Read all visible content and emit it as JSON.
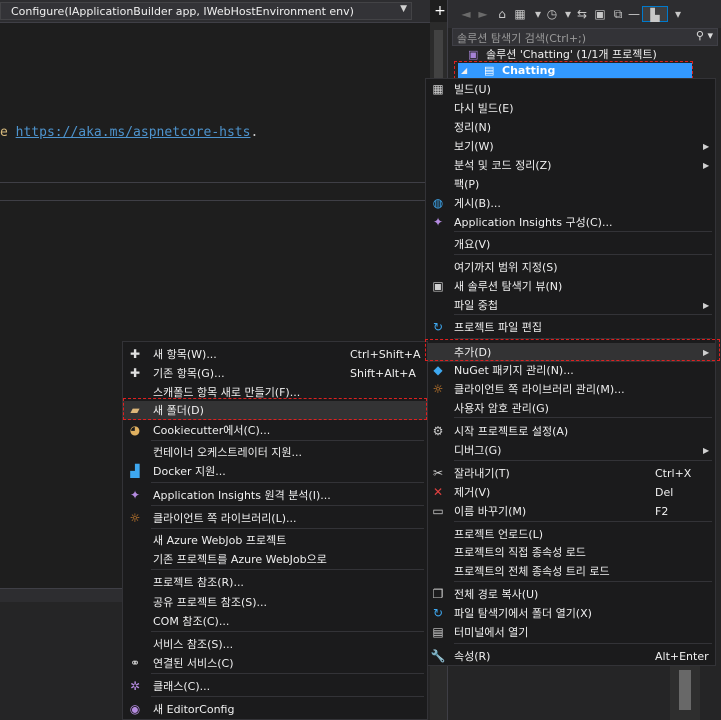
{
  "editor": {
    "method_signature": "Configure(IApplicationBuilder app, IWebHostEnvironment env)",
    "code_prefix": "e",
    "code_link": "https://aka.ms/aspnetcore-hsts",
    "code_suffix": ".",
    "split_button": "+"
  },
  "solution_explorer": {
    "search_placeholder": "솔루션 탐색기 검색(Ctrl+;)",
    "solution_label": "솔루션 'Chatting' (1/1개 프로젝트)",
    "project_label": "Chatting"
  },
  "project_menu": {
    "items": [
      {
        "label": "빌드(U)",
        "icon": "build-icon"
      },
      {
        "label": "다시 빌드(E)"
      },
      {
        "label": "정리(N)"
      },
      {
        "label": "보기(W)",
        "submenu": true
      },
      {
        "label": "분석 및 코드 정리(Z)",
        "submenu": true
      },
      {
        "label": "팩(P)"
      },
      {
        "label": "게시(B)...",
        "icon": "publish-globe-icon"
      },
      {
        "label": "Application Insights 구성(C)...",
        "icon": "app-insights-icon"
      },
      {
        "label": "개요(V)"
      },
      {
        "label": "여기까지 범위 지정(S)"
      },
      {
        "label": "새 솔루션 탐색기 뷰(N)",
        "icon": "new-view-icon"
      },
      {
        "label": "파일 중첩",
        "submenu": true
      },
      {
        "label": "프로젝트 파일 편집",
        "icon": "edit-project-icon"
      },
      {
        "label": "추가(D)",
        "submenu": true
      },
      {
        "label": "NuGet 패키지 관리(N)...",
        "icon": "nuget-icon"
      },
      {
        "label": "클라이언트 쪽 라이브러리 관리(M)...",
        "icon": "client-library-icon"
      },
      {
        "label": "사용자 암호 관리(G)"
      },
      {
        "label": "시작 프로젝트로 설정(A)",
        "icon": "gear-icon"
      },
      {
        "label": "디버그(G)",
        "submenu": true
      },
      {
        "label": "잘라내기(T)",
        "shortcut": "Ctrl+X",
        "icon": "scissors-icon"
      },
      {
        "label": "제거(V)",
        "shortcut": "Del",
        "icon": "remove-x-icon"
      },
      {
        "label": "이름 바꾸기(M)",
        "shortcut": "F2",
        "icon": "rename-icon"
      },
      {
        "label": "프로젝트 언로드(L)"
      },
      {
        "label": "프로젝트의 직접 종속성 로드"
      },
      {
        "label": "프로젝트의 전체 종속성 트리 로드"
      },
      {
        "label": "전체 경로 복사(U)",
        "icon": "copy-icon"
      },
      {
        "label": "파일 탐색기에서 폴더 열기(X)",
        "icon": "open-folder-icon"
      },
      {
        "label": "터미널에서 열기",
        "icon": "terminal-icon"
      },
      {
        "label": "속성(R)",
        "shortcut": "Alt+Enter",
        "icon": "wrench-icon"
      }
    ]
  },
  "add_menu": {
    "items": [
      {
        "label": "새 항목(W)...",
        "shortcut": "Ctrl+Shift+A",
        "icon": "new-item-icon"
      },
      {
        "label": "기존 항목(G)...",
        "shortcut": "Shift+Alt+A",
        "icon": "existing-item-icon"
      },
      {
        "label": "스캐폴드 항목 새로 만들기(F)..."
      },
      {
        "label": "새 폴더(D)",
        "icon": "new-folder-icon"
      },
      {
        "label": "Cookiecutter에서(C)...",
        "icon": "cookiecutter-icon"
      },
      {
        "label": "컨테이너 오케스트레이터 지원..."
      },
      {
        "label": "Docker 지원...",
        "icon": "docker-icon"
      },
      {
        "label": "Application Insights 원격 분석(I)...",
        "icon": "app-insights-icon"
      },
      {
        "label": "클라이언트 쪽 라이브러리(L)...",
        "icon": "client-library-icon"
      },
      {
        "label": "새 Azure WebJob 프로젝트"
      },
      {
        "label": "기존 프로젝트를 Azure WebJob으로"
      },
      {
        "label": "프로젝트 참조(R)..."
      },
      {
        "label": "공유 프로젝트 참조(S)..."
      },
      {
        "label": "COM 참조(C)..."
      },
      {
        "label": "서비스 참조(S)..."
      },
      {
        "label": "연결된 서비스(C)",
        "icon": "connected-services-icon"
      },
      {
        "label": "클래스(C)...",
        "icon": "class-icon"
      },
      {
        "label": "새 EditorConfig",
        "icon": "editorconfig-icon"
      }
    ]
  }
}
